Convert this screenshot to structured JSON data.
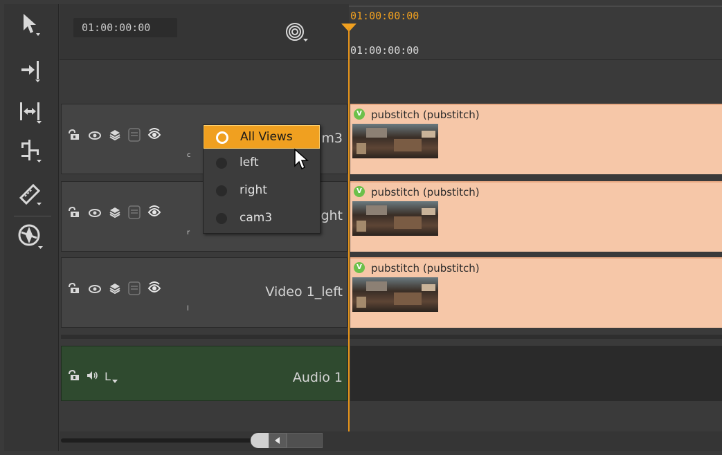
{
  "header": {
    "timecode": "01:00:00:00"
  },
  "ruler": {
    "playhead_timecode": "01:00:00:00",
    "start_timecode": "01:00:00:00"
  },
  "tools": {
    "items": [
      "pointer-tool",
      "track-select-tool",
      "slip-tool",
      "multi-track-tool",
      "razor-tool",
      "nuke-tool"
    ]
  },
  "tracks": [
    {
      "name": "Video 1_cam3",
      "visible_name_suffix": "m3",
      "view_letter": "c",
      "clip": {
        "badge": "V",
        "label": "pubstitch (pubstitch)"
      }
    },
    {
      "name": "Video 1_right",
      "visible_name_suffix": "ght",
      "view_letter": "r",
      "clip": {
        "badge": "V",
        "label": "pubstitch (pubstitch)"
      }
    },
    {
      "name": "Video 1_left",
      "visible_name_suffix": "Video 1_left",
      "view_letter": "l",
      "clip": {
        "badge": "V",
        "label": "pubstitch (pubstitch)"
      }
    }
  ],
  "audio": {
    "name": "Audio 1",
    "channel": "L"
  },
  "views_menu": {
    "items": [
      {
        "label": "All Views",
        "selected": true
      },
      {
        "label": "left",
        "selected": false
      },
      {
        "label": "right",
        "selected": false
      },
      {
        "label": "cam3",
        "selected": false
      }
    ]
  },
  "colors": {
    "accent": "#f0a020",
    "clip": "#f6c7a8",
    "audio_track": "#2f4a2f",
    "badge": "#6cc04a"
  }
}
